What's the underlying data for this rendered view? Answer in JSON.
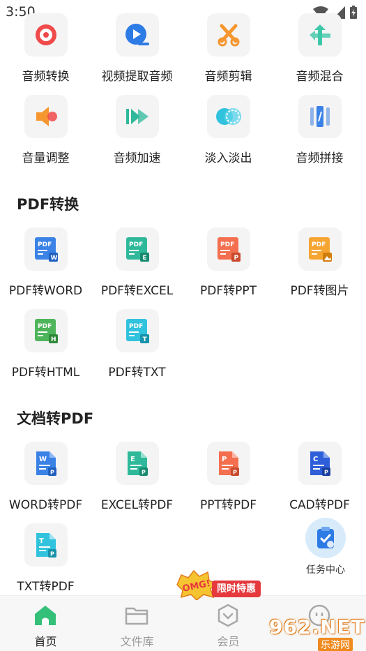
{
  "status_bar": {
    "time": "3:50"
  },
  "audio_tools": [
    {
      "label": "音频转换",
      "icon": "music-disc-icon"
    },
    {
      "label": "视频提取音频",
      "icon": "video-play-icon"
    },
    {
      "label": "音频剪辑",
      "icon": "scissors-icon"
    },
    {
      "label": "音频混合",
      "icon": "merge-arrows-icon"
    },
    {
      "label": "音量调整",
      "icon": "speaker-icon"
    },
    {
      "label": "音频加速",
      "icon": "fast-forward-icon"
    },
    {
      "label": "淡入淡出",
      "icon": "fade-circles-icon"
    },
    {
      "label": "音频拼接",
      "icon": "splice-bars-icon"
    }
  ],
  "pdf_convert": {
    "title": "PDF转换",
    "items": [
      {
        "label": "PDF转WORD",
        "icon": "pdf-to-word-icon",
        "color": "#3b82e6",
        "badge": "W"
      },
      {
        "label": "PDF转EXCEL",
        "icon": "pdf-to-excel-icon",
        "color": "#2fb99a",
        "badge": "E"
      },
      {
        "label": "PDF转PPT",
        "icon": "pdf-to-ppt-icon",
        "color": "#f36f4f",
        "badge": "P"
      },
      {
        "label": "PDF转图片",
        "icon": "pdf-to-image-icon",
        "color": "#f7a531",
        "badge": "▲"
      },
      {
        "label": "PDF转HTML",
        "icon": "pdf-to-html-icon",
        "color": "#4fb55b",
        "badge": "H"
      },
      {
        "label": "PDF转TXT",
        "icon": "pdf-to-txt-icon",
        "color": "#31c2dd",
        "badge": "T"
      }
    ]
  },
  "doc_to_pdf": {
    "title": "文档转PDF",
    "items": [
      {
        "label": "WORD转PDF",
        "icon": "word-to-pdf-icon",
        "color": "#3b82e6",
        "letter": "W"
      },
      {
        "label": "EXCEL转PDF",
        "icon": "excel-to-pdf-icon",
        "color": "#2fb99a",
        "letter": "E"
      },
      {
        "label": "PPT转PDF",
        "icon": "ppt-to-pdf-icon",
        "color": "#f36f4f",
        "letter": "P"
      },
      {
        "label": "CAD转PDF",
        "icon": "cad-to-pdf-icon",
        "color": "#2f5fd8",
        "letter": "C"
      },
      {
        "label": "TXT转PDF",
        "icon": "txt-to-pdf-icon",
        "color": "#31c2dd",
        "letter": "T"
      }
    ]
  },
  "task_center": {
    "label": "任务中心"
  },
  "promo": {
    "burst_text": "OMG!",
    "badge_text": "限时特惠"
  },
  "bottom_nav": [
    {
      "label": "首页",
      "icon": "home-icon",
      "active": true
    },
    {
      "label": "文件库",
      "icon": "folder-icon",
      "active": false
    },
    {
      "label": "会员",
      "icon": "vip-shield-icon",
      "active": false
    },
    {
      "label": "",
      "icon": "profile-icon",
      "active": false
    }
  ],
  "watermark": {
    "text": "962.NET",
    "sub": "乐游网"
  },
  "colors": {
    "accent_green": "#35c07a",
    "inactive": "#999999",
    "promo_red": "#e5393d"
  }
}
